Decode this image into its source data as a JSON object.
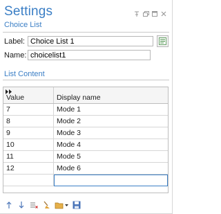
{
  "header": {
    "title": "Settings",
    "subtitle": "Choice List"
  },
  "window_controls": [
    "pin-icon",
    "float-icon",
    "maximize-icon",
    "close-icon"
  ],
  "form": {
    "label_caption": "Label:",
    "label_value": "Choice List 1",
    "name_caption": "Name:",
    "name_value": "choicelist1"
  },
  "list_content": {
    "section_title": "List Content",
    "columns": [
      "Value",
      "Display name"
    ],
    "rows": [
      [
        "7",
        "Mode 1"
      ],
      [
        "8",
        "Mode 2"
      ],
      [
        "9",
        "Mode 3"
      ],
      [
        "10",
        "Mode 4"
      ],
      [
        "11",
        "Mode 5"
      ],
      [
        "12",
        "Mode 6"
      ]
    ]
  },
  "toolbar_icons": [
    "move-up-icon",
    "move-down-icon",
    "delete-icon",
    "clear-icon",
    "open-file-icon",
    "save-icon"
  ],
  "colors": {
    "accent": "#3a7ec5",
    "border": "#bdbdbd"
  }
}
